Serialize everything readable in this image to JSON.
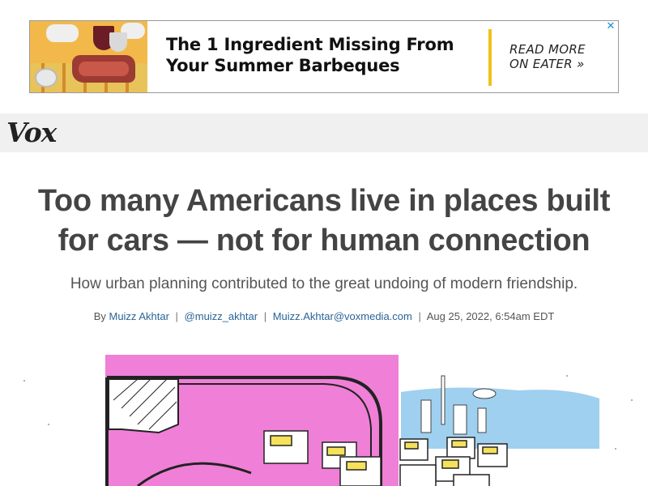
{
  "ad": {
    "headline_line1": "The 1 Ingredient Missing From",
    "headline_line2": "Your Summer Barbeques",
    "cta_line1": "READ MORE",
    "cta_line2": "ON EATER »",
    "close_glyph": "✕"
  },
  "nav": {
    "logo": "Vox"
  },
  "article": {
    "headline_line1": "Too many Americans live in places built",
    "headline_line2": "for cars — not for human connection",
    "dek": "How urban planning contributed to the great undoing of modern friendship.",
    "byline": {
      "by": "By",
      "author": "Muizz Akhtar",
      "twitter": "@muizz_akhtar",
      "email": "Muizz.Akhtar@voxmedia.com",
      "date": "Aug 25, 2022, 6:54am EDT",
      "separator": "|"
    }
  },
  "colors": {
    "accent_yellow": "#f2c11a",
    "link_blue": "#2a6496",
    "hero_pink": "#f07fd8",
    "hero_sky": "#9fd0ef"
  }
}
